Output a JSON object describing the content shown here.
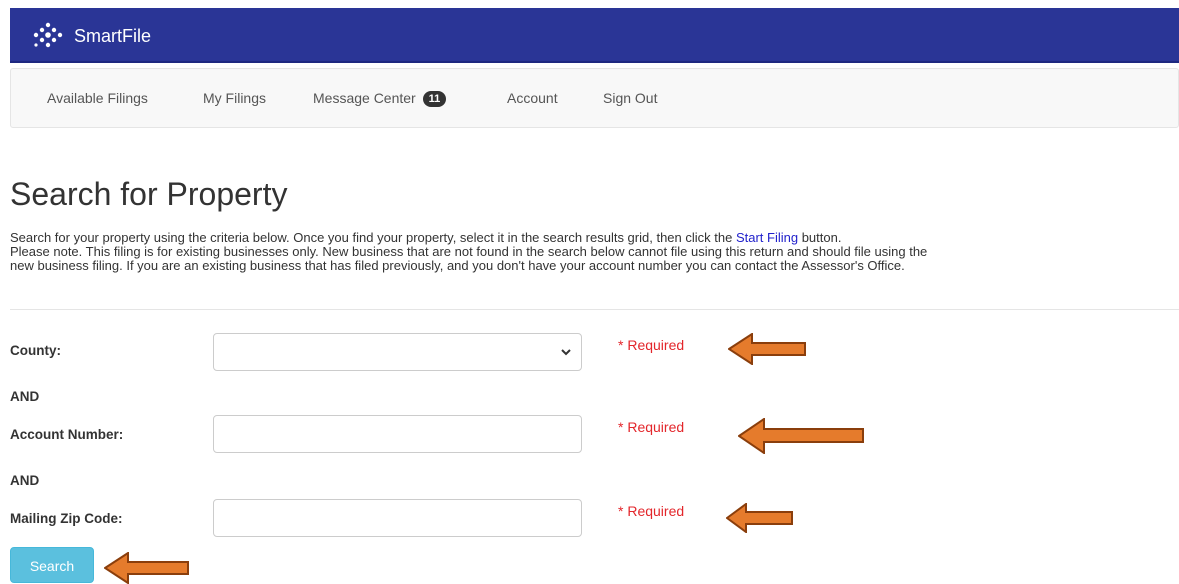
{
  "header": {
    "brand": "SmartFile"
  },
  "nav": {
    "items": [
      {
        "label": "Available Filings"
      },
      {
        "label": "My Filings"
      },
      {
        "label": "Message Center",
        "badge": "11"
      },
      {
        "label": "Account"
      },
      {
        "label": "Sign Out"
      }
    ]
  },
  "page": {
    "title": "Search for Property",
    "intro": {
      "line1_before": "Search for your property using the criteria below. Once you find your property, select it in the search results grid, then click the ",
      "line1_link": "Start Filing",
      "line1_after": " button.",
      "line2": "Please note. This filing is for existing businesses only. New business that are not found in the search below cannot file using this return and should file using the",
      "line3": "new business filing. If you are an existing business that has filed previously, and you don't have your account number you can contact the Assessor's Office."
    }
  },
  "form": {
    "county": {
      "label": "County:",
      "value": "",
      "required": "* Required"
    },
    "and1": "AND",
    "account": {
      "label": "Account Number:",
      "value": "",
      "required": "* Required"
    },
    "and2": "AND",
    "zip": {
      "label": "Mailing Zip Code:",
      "value": "",
      "required": "* Required"
    },
    "search_button": "Search"
  },
  "colors": {
    "header_bg": "#2a3596",
    "required_text": "#e3262b",
    "search_button": "#5bc0de",
    "annotation_arrow": "#e57b2c",
    "link": "#2222cc"
  },
  "icons": {
    "logo": "smartfile-dots-logo-icon",
    "select": "chevron-down-icon",
    "annotation": "arrow-left-icon"
  }
}
